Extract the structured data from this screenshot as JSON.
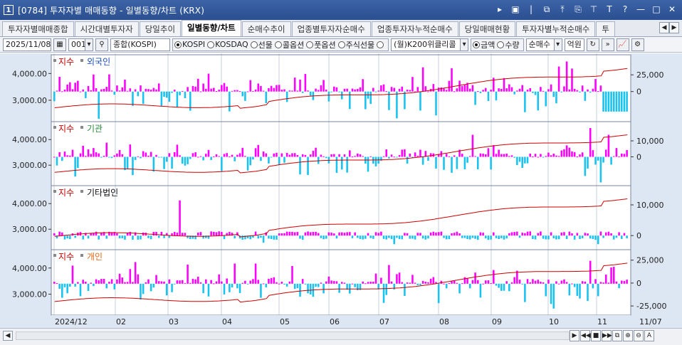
{
  "window": {
    "number": "1",
    "title": "[0784] 투자자별 매매동향 - 일별동향/차트 (KRX)"
  },
  "tabs": [
    {
      "label": "투자자별매매종합",
      "active": false
    },
    {
      "label": "시간대별투자자",
      "active": false
    },
    {
      "label": "당일추이",
      "active": false
    },
    {
      "label": "일별동향/차트",
      "active": true
    },
    {
      "label": "순매수추이",
      "active": false
    },
    {
      "label": "업종별투자자순매수",
      "active": false
    },
    {
      "label": "업종투자자누적순매수",
      "active": false
    },
    {
      "label": "당일매매현황",
      "active": false
    },
    {
      "label": "투자자별누적순매수",
      "active": false
    },
    {
      "label": "투",
      "active": false
    }
  ],
  "toolbar": {
    "date": "2025/11/08",
    "code": "001",
    "market_name": "종합(KOSPI)",
    "markets": [
      {
        "label": "KOSPI",
        "selected": true
      },
      {
        "label": "KOSDAQ",
        "selected": false
      },
      {
        "label": "선물",
        "selected": false
      },
      {
        "label": "콜옵션",
        "selected": false
      },
      {
        "label": "풋옵션",
        "selected": false
      },
      {
        "label": "주식선물",
        "selected": false
      },
      {
        "label": "",
        "selected": false
      }
    ],
    "index_select": "(월)K200위클리콜",
    "amount_types": [
      {
        "label": "금액",
        "selected": true
      },
      {
        "label": "수량",
        "selected": false
      }
    ],
    "trade_type": "순매수",
    "unit": "억원"
  },
  "chart": {
    "x_labels": [
      "2024/12",
      "02",
      "03",
      "04",
      "05",
      "06",
      "07",
      "08",
      "09",
      "10",
      "11"
    ],
    "last_date_label": "11/07",
    "panels": [
      {
        "index_label": "지수",
        "investor": "외국인",
        "investor_color": "#1f4fb8",
        "left_ticks": [
          "4,000.00",
          "3,000.00"
        ],
        "right_ticks": [
          "25,000",
          "0"
        ]
      },
      {
        "index_label": "지수",
        "investor": "기관",
        "investor_color": "#2b8a3e",
        "left_ticks": [
          "4,000.00",
          "3,000.00"
        ],
        "right_ticks": [
          "10,000",
          "0"
        ]
      },
      {
        "index_label": "지수",
        "investor": "기타법인",
        "investor_color": "#111111",
        "left_ticks": [
          "4,000.00",
          "3,000.00"
        ],
        "right_ticks": [
          "10,000",
          "0"
        ]
      },
      {
        "index_label": "지수",
        "investor": "개인",
        "investor_color": "#e06a1a",
        "left_ticks": [
          "4,000.00",
          "3,000.00"
        ],
        "right_ticks": [
          "25,000",
          "0",
          "-25,000"
        ]
      }
    ],
    "colors": {
      "positive_bar": "#ff00ff",
      "negative_bar": "#19c3f0",
      "index_line": "#cc0000",
      "axis_bg": "#dde6f3",
      "grid": "#c8cfdb"
    }
  }
}
